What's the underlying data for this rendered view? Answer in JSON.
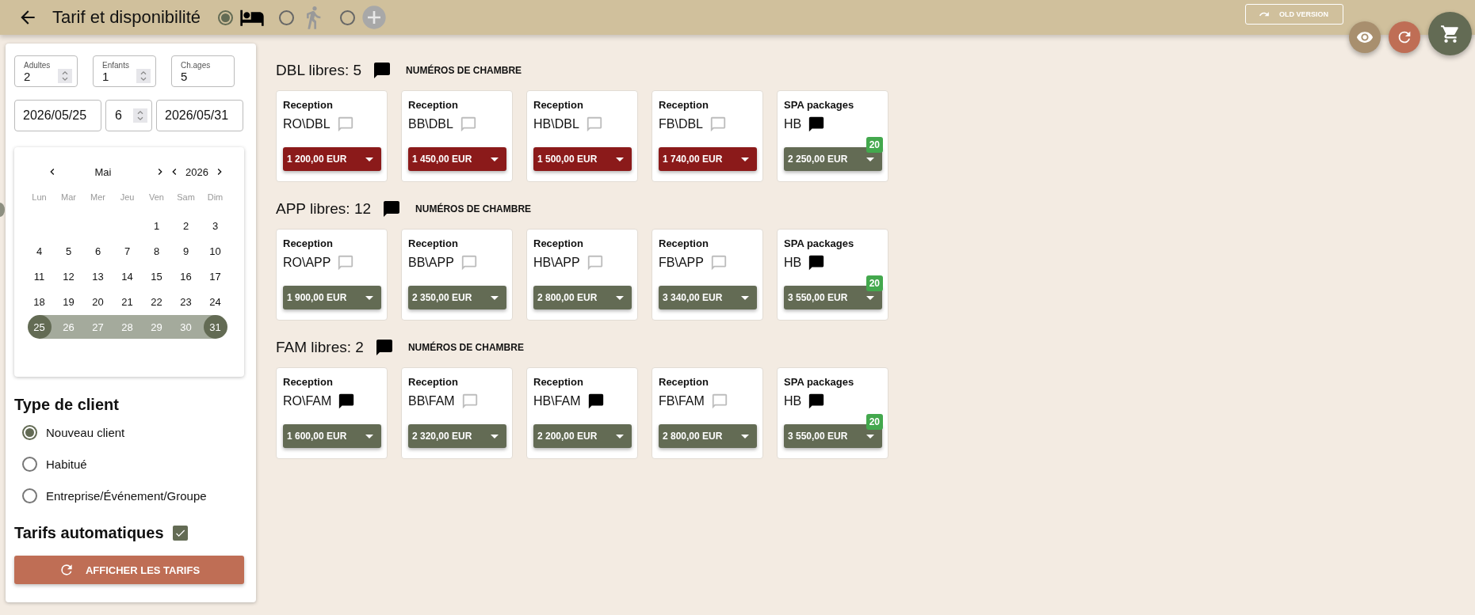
{
  "topbar": {
    "title": "Tarif et disponibilité",
    "modes": [
      {
        "kind": "bed",
        "selected": true
      },
      {
        "kind": "runner",
        "selected": false
      },
      {
        "kind": "plus",
        "selected": false
      }
    ],
    "old_version": "OLD VERSION"
  },
  "search": {
    "guests": [
      {
        "label": "Adultes",
        "value": "2",
        "spinner": true
      },
      {
        "label": "Enfants",
        "value": "1",
        "spinner": true
      },
      {
        "label": "Ch.ages",
        "value": "5",
        "spinner": false
      }
    ],
    "arrival": "2026/05/25",
    "nights": "6",
    "departure": "2026/05/31"
  },
  "calendar": {
    "month": "Mai",
    "year": "2026",
    "weekdays": [
      "Lun",
      "Mar",
      "Mer",
      "Jeu",
      "Ven",
      "Sam",
      "Dim"
    ],
    "days": [
      {
        "kind": "blank"
      },
      {
        "kind": "blank"
      },
      {
        "kind": "blank"
      },
      {
        "kind": "blank"
      },
      {
        "kind": "day",
        "label": "1",
        "selected": false,
        "in_range": false
      },
      {
        "kind": "day",
        "label": "2",
        "selected": false,
        "in_range": false
      },
      {
        "kind": "day",
        "label": "3",
        "selected": false,
        "in_range": false
      },
      {
        "kind": "day",
        "label": "4",
        "selected": false,
        "in_range": false
      },
      {
        "kind": "day",
        "label": "5",
        "selected": false,
        "in_range": false
      },
      {
        "kind": "day",
        "label": "6",
        "selected": false,
        "in_range": false
      },
      {
        "kind": "day",
        "label": "7",
        "selected": false,
        "in_range": false
      },
      {
        "kind": "day",
        "label": "8",
        "selected": false,
        "in_range": false
      },
      {
        "kind": "day",
        "label": "9",
        "selected": false,
        "in_range": false
      },
      {
        "kind": "day",
        "label": "10",
        "selected": false,
        "in_range": false
      },
      {
        "kind": "day",
        "label": "11",
        "selected": false,
        "in_range": false
      },
      {
        "kind": "day",
        "label": "12",
        "selected": false,
        "in_range": false
      },
      {
        "kind": "day",
        "label": "13",
        "selected": false,
        "in_range": false
      },
      {
        "kind": "day",
        "label": "14",
        "selected": false,
        "in_range": false
      },
      {
        "kind": "day",
        "label": "15",
        "selected": false,
        "in_range": false
      },
      {
        "kind": "day",
        "label": "16",
        "selected": false,
        "in_range": false
      },
      {
        "kind": "day",
        "label": "17",
        "selected": false,
        "in_range": false
      },
      {
        "kind": "day",
        "label": "18",
        "selected": false,
        "in_range": false
      },
      {
        "kind": "day",
        "label": "19",
        "selected": false,
        "in_range": false
      },
      {
        "kind": "day",
        "label": "20",
        "selected": false,
        "in_range": false
      },
      {
        "kind": "day",
        "label": "21",
        "selected": false,
        "in_range": false
      },
      {
        "kind": "day",
        "label": "22",
        "selected": false,
        "in_range": false
      },
      {
        "kind": "day",
        "label": "23",
        "selected": false,
        "in_range": false
      },
      {
        "kind": "day",
        "label": "24",
        "selected": false,
        "in_range": false
      },
      {
        "kind": "day",
        "label": "25",
        "selected": true,
        "in_range": false
      },
      {
        "kind": "day",
        "label": "26",
        "selected": false,
        "in_range": true
      },
      {
        "kind": "day",
        "label": "27",
        "selected": false,
        "in_range": true
      },
      {
        "kind": "day",
        "label": "28",
        "selected": false,
        "in_range": true
      },
      {
        "kind": "day",
        "label": "29",
        "selected": false,
        "in_range": true
      },
      {
        "kind": "day",
        "label": "30",
        "selected": false,
        "in_range": true
      },
      {
        "kind": "day",
        "label": "31",
        "selected": true,
        "in_range": false
      }
    ]
  },
  "client_type": {
    "title": "Type de client",
    "options": [
      {
        "label": "Nouveau client",
        "selected": true
      },
      {
        "label": "Habitué",
        "selected": false
      },
      {
        "label": "Entreprise/Événement/Groupe",
        "selected": false
      }
    ]
  },
  "auto_rates": {
    "label": "Tarifs automatiques",
    "checked": true
  },
  "show_button": "AFFICHER LES TARIFS",
  "rooms": [
    {
      "title": "DBL libres: 5",
      "has_comment": true,
      "numbers_link": "NUMÉROS DE CHAMBRE",
      "rates": [
        {
          "source": "Reception",
          "code": "RO\\DBL",
          "has_comment": false,
          "price": "1 200,00 EUR",
          "color": "#8b1a1a"
        },
        {
          "source": "Reception",
          "code": "BB\\DBL",
          "has_comment": false,
          "price": "1 450,00 EUR",
          "color": "#8b1a1a"
        },
        {
          "source": "Reception",
          "code": "HB\\DBL",
          "has_comment": false,
          "price": "1 500,00 EUR",
          "color": "#8b1a1a"
        },
        {
          "source": "Reception",
          "code": "FB\\DBL",
          "has_comment": false,
          "price": "1 740,00 EUR",
          "color": "#8b1a1a"
        },
        {
          "source": "SPA packages",
          "code": "HB",
          "has_comment": true,
          "price": "2 250,00 EUR",
          "color": "#636b54",
          "badge": "20"
        }
      ]
    },
    {
      "title": "APP libres: 12",
      "has_comment": true,
      "numbers_link": "NUMÉROS DE CHAMBRE",
      "rates": [
        {
          "source": "Reception",
          "code": "RO\\APP",
          "has_comment": false,
          "price": "1 900,00 EUR",
          "color": "#636b54"
        },
        {
          "source": "Reception",
          "code": "BB\\APP",
          "has_comment": false,
          "price": "2 350,00 EUR",
          "color": "#636b54"
        },
        {
          "source": "Reception",
          "code": "HB\\APP",
          "has_comment": false,
          "price": "2 800,00 EUR",
          "color": "#636b54"
        },
        {
          "source": "Reception",
          "code": "FB\\APP",
          "has_comment": false,
          "price": "3 340,00 EUR",
          "color": "#636b54"
        },
        {
          "source": "SPA packages",
          "code": "HB",
          "has_comment": true,
          "price": "3 550,00 EUR",
          "color": "#636b54",
          "badge": "20"
        }
      ]
    },
    {
      "title": "FAM libres: 2",
      "has_comment": true,
      "numbers_link": "NUMÉROS DE CHAMBRE",
      "rates": [
        {
          "source": "Reception",
          "code": "RO\\FAM",
          "has_comment": true,
          "price": "1 600,00 EUR",
          "color": "#636b54"
        },
        {
          "source": "Reception",
          "code": "BB\\FAM",
          "has_comment": false,
          "price": "2 320,00 EUR",
          "color": "#636b54"
        },
        {
          "source": "Reception",
          "code": "HB\\FAM",
          "has_comment": true,
          "price": "2 200,00 EUR",
          "color": "#636b54"
        },
        {
          "source": "Reception",
          "code": "FB\\FAM",
          "has_comment": false,
          "price": "2 800,00 EUR",
          "color": "#636b54"
        },
        {
          "source": "SPA packages",
          "code": "HB",
          "has_comment": true,
          "price": "3 550,00 EUR",
          "color": "#636b54",
          "badge": "20"
        }
      ]
    }
  ]
}
